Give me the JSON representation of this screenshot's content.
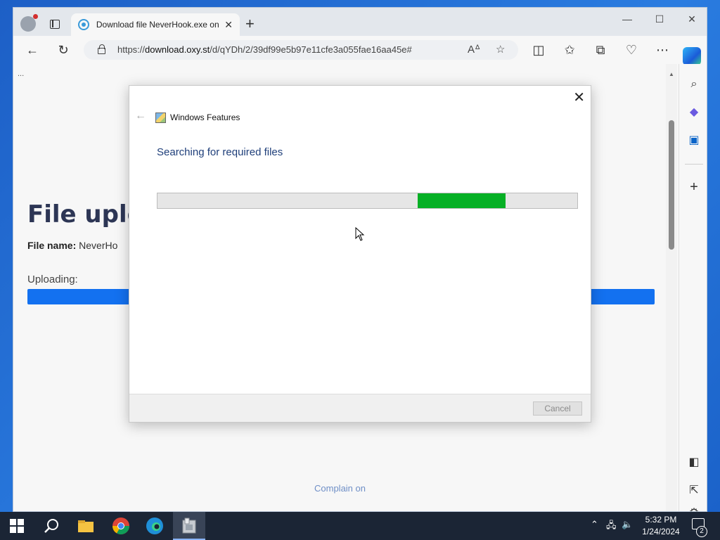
{
  "browser": {
    "tab_title": "Download file NeverHook.exe on",
    "tab_close": "✕",
    "new_tab": "+",
    "window_minimize": "—",
    "window_maximize": "☐",
    "window_close": "✕",
    "url_prefix": "https://",
    "url_host": "download.oxy.st",
    "url_path": "/d/qYDh/2/39df99e5b97e11cfe3a055fae16aa45e#"
  },
  "page": {
    "dots": "...",
    "title": "File uplo",
    "file_name_label": "File name:",
    "file_name_value": "NeverHo",
    "uploading_label": "Uploading:",
    "complain_link": "Complain on"
  },
  "dialog": {
    "app_title": "Windows Features",
    "heading": "Searching for required files",
    "close": "✕",
    "back": "←",
    "cancel_label": "Cancel",
    "progress_start": 0.62,
    "progress_end": 0.83
  },
  "taskbar": {
    "time": "5:32 PM",
    "date": "1/24/2024",
    "notification_count": "2"
  },
  "colors": {
    "progress_green": "#06b025",
    "upload_blue": "#1371f0",
    "heading_blue": "#1f3f7a"
  },
  "icons": [
    "profile-icon",
    "tab-actions-icon",
    "edge-favicon-icon",
    "back-arrow-icon",
    "refresh-icon",
    "lock-icon",
    "read-aloud-icon",
    "favorite-star-icon",
    "split-screen-icon",
    "favorites-icon",
    "collections-icon",
    "browser-essentials-icon",
    "more-icon",
    "copilot-icon",
    "search-icon",
    "copilot-sidebar-icon",
    "outlook-icon",
    "add-icon",
    "sidebar-toggle-icon",
    "open-external-icon",
    "settings-icon",
    "windows-start-icon",
    "file-explorer-icon",
    "chrome-icon",
    "edge-icon",
    "installer-icon"
  ]
}
